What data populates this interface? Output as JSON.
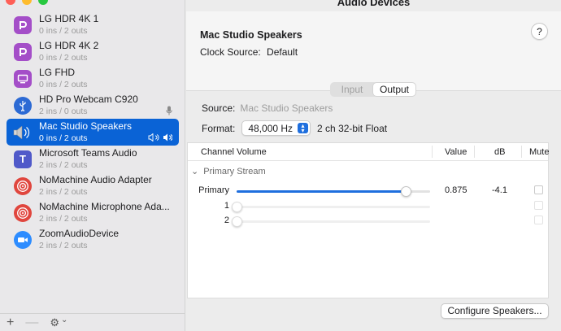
{
  "window": {
    "title": "Audio Devices"
  },
  "devices": [
    {
      "name": "LG HDR 4K 1",
      "io": "0 ins / 2 outs",
      "icon": "displayport-icon",
      "selected": false
    },
    {
      "name": "LG HDR 4K 2",
      "io": "0 ins / 2 outs",
      "icon": "displayport-icon",
      "selected": false
    },
    {
      "name": "LG FHD",
      "io": "0 ins / 2 outs",
      "icon": "display-icon",
      "selected": false
    },
    {
      "name": "HD Pro Webcam C920",
      "io": "2 ins / 0 outs",
      "icon": "usb-icon",
      "selected": false
    },
    {
      "name": "Mac Studio Speakers",
      "io": "0 ins / 2 outs",
      "icon": "speaker-icon",
      "selected": true
    },
    {
      "name": "Microsoft Teams Audio",
      "io": "2 ins / 2 outs",
      "icon": "teams-icon",
      "selected": false
    },
    {
      "name": "NoMachine Audio Adapter",
      "io": "2 ins / 2 outs",
      "icon": "nomachine-icon",
      "selected": false
    },
    {
      "name": "NoMachine Microphone Ada...",
      "io": "2 ins / 2 outs",
      "icon": "nomachine-icon",
      "selected": false
    },
    {
      "name": "ZoomAudioDevice",
      "io": "2 ins / 2 outs",
      "icon": "zoom-icon",
      "selected": false
    }
  ],
  "detail": {
    "device_name": "Mac Studio Speakers",
    "clock_label": "Clock Source:",
    "clock_value": "Default",
    "help": "?",
    "tabs": [
      "Input",
      "Output"
    ],
    "active_tab": "Output",
    "source_label": "Source:",
    "source_value": "Mac Studio Speakers",
    "format_label": "Format:",
    "format_rate": "48,000 Hz",
    "format_desc": "2 ch 32-bit Float"
  },
  "table": {
    "headers": {
      "channel": "Channel Volume",
      "value": "Value",
      "db": "dB",
      "mute": "Mute"
    },
    "stream": "Primary Stream",
    "rows": [
      {
        "label": "Primary",
        "level": 0.875,
        "value": "0.875",
        "db": "-4.1",
        "enabled": true
      },
      {
        "label": "1",
        "level": 0,
        "value": "",
        "db": "",
        "enabled": false
      },
      {
        "label": "2",
        "level": 0,
        "value": "",
        "db": "",
        "enabled": false
      }
    ]
  },
  "configure_button": "Configure Speakers...",
  "footer": {
    "add": "+",
    "remove": "—",
    "gear": "⚙",
    "gear_chevron": "⌄"
  },
  "colors": {
    "accent": "#1f6fde",
    "selection": "#0a63d6"
  }
}
